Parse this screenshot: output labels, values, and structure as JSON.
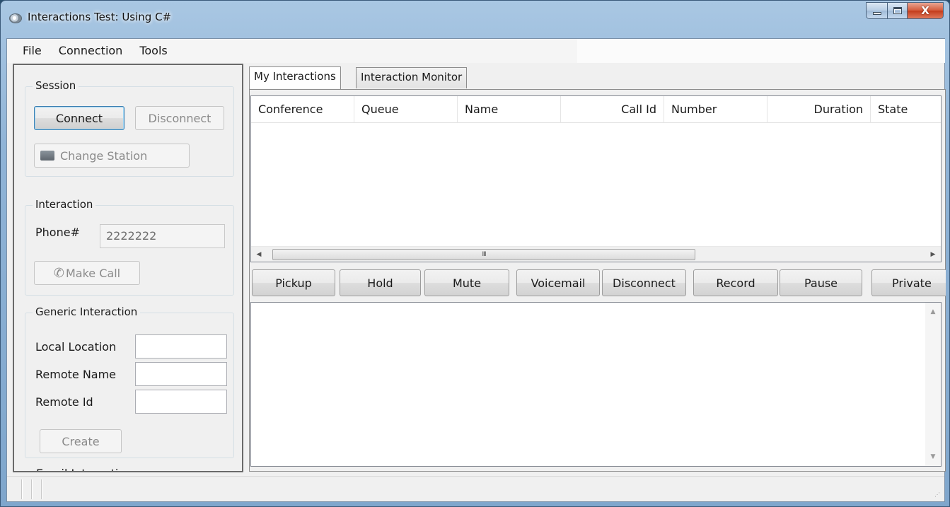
{
  "window": {
    "title": "Interactions Test: Using C#",
    "controls": {
      "minimize": "minimize",
      "maximize": "maximize",
      "close": "X"
    }
  },
  "menu": [
    "File",
    "Connection",
    "Tools"
  ],
  "session": {
    "title": "Session",
    "connect_label": "Connect",
    "disconnect_label": "Disconnect",
    "change_station_label": "Change Station"
  },
  "interaction": {
    "title": "Interaction",
    "phone_label": "Phone#",
    "phone_value": "2222222",
    "make_call_label": "Make Call"
  },
  "generic_interaction": {
    "title": "Generic Interaction",
    "local_location_label": "Local Location",
    "remote_name_label": "Remote Name",
    "remote_id_label": "Remote Id",
    "local_location_value": "",
    "remote_name_value": "",
    "remote_id_value": "",
    "create_label": "Create"
  },
  "email_interaction": {
    "title": "Email Interaction"
  },
  "tabs": [
    {
      "label": "My Interactions",
      "active": true
    },
    {
      "label": "Interaction Monitor",
      "active": false
    }
  ],
  "list": {
    "columns": [
      "Conference",
      "Queue",
      "Name",
      "Call Id",
      "Number",
      "Duration",
      "State"
    ],
    "rows": [],
    "scroll_thumb_glyph": "III"
  },
  "actions": [
    "Pickup",
    "Hold",
    "Mute",
    "Voicemail",
    "Disconnect",
    "Record",
    "Pause",
    "Private"
  ],
  "log_text": ""
}
